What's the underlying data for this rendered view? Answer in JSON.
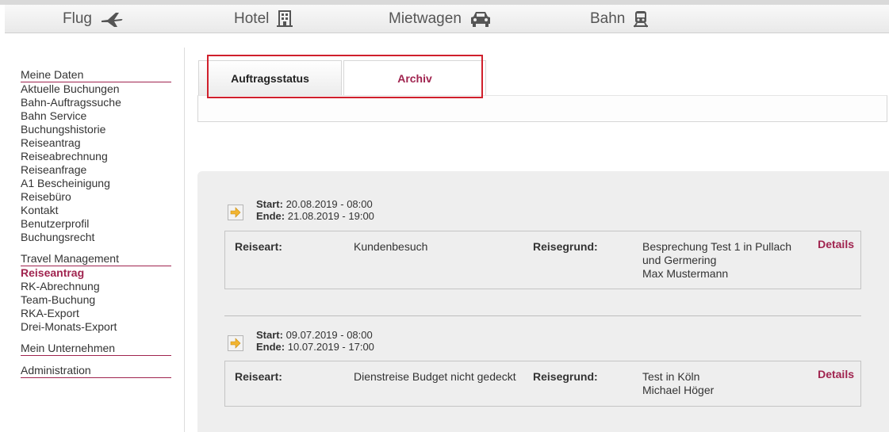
{
  "topnav": {
    "items": [
      {
        "label": "Flug",
        "icon": "airplane-icon"
      },
      {
        "label": "Hotel",
        "icon": "hotel-building-icon"
      },
      {
        "label": "Mietwagen",
        "icon": "car-icon"
      },
      {
        "label": "Bahn",
        "icon": "train-icon"
      }
    ]
  },
  "sidebar": {
    "sections": [
      {
        "title": "Meine Daten",
        "items": [
          "Aktuelle Buchungen",
          "Bahn-Auftragssuche",
          "Bahn Service",
          "Buchungshistorie",
          "Reiseantrag",
          "Reiseabrechnung",
          "Reiseanfrage",
          "A1 Bescheinigung",
          "Reisebüro",
          "Kontakt",
          "Benutzerprofil",
          "Buchungsrecht"
        ]
      },
      {
        "title": "Travel Management",
        "items": [
          "Reiseantrag",
          "RK-Abrechnung",
          "Team-Buchung",
          "RKA-Export",
          "Drei-Monats-Export"
        ],
        "active": "Reiseantrag"
      },
      {
        "title": "Mein Unternehmen",
        "items": []
      },
      {
        "title": "Administration",
        "items": []
      }
    ]
  },
  "tabs": [
    {
      "label": "Auftragsstatus",
      "active": true
    },
    {
      "label": "Archiv",
      "active": false
    }
  ],
  "trips": [
    {
      "start_label": "Start:",
      "start": "20.08.2019 - 08:00",
      "end_label": "Ende:",
      "end": "21.08.2019 - 19:00",
      "reiseart_label": "Reiseart:",
      "reiseart": "Kundenbesuch",
      "reisegrund_label": "Reisegrund:",
      "reisegrund": "Besprechung Test 1 in Pullach und Germering",
      "person": "Max  Mustermann",
      "details_label": "Details"
    },
    {
      "start_label": "Start:",
      "start": "09.07.2019 - 08:00",
      "end_label": "Ende:",
      "end": "10.07.2019 - 17:00",
      "reiseart_label": "Reiseart:",
      "reiseart": "Dienstreise Budget nicht gedeckt",
      "reisegrund_label": "Reisegrund:",
      "reisegrund": "Test in Köln",
      "person": "Michael  Höger",
      "details_label": "Details"
    }
  ],
  "colors": {
    "accent": "#a0244f",
    "highlight": "#d0202c",
    "panel": "#eeeeee"
  }
}
